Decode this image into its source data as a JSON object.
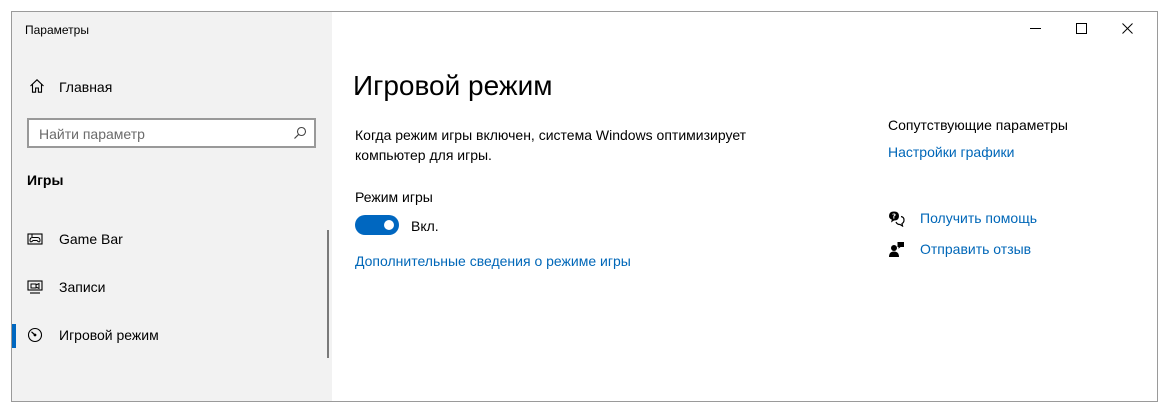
{
  "window": {
    "title": "Параметры"
  },
  "sidebar": {
    "home_label": "Главная",
    "search_placeholder": "Найти параметр",
    "section_title": "Игры",
    "items": [
      {
        "label": "Game Bar",
        "icon": "game-bar-icon"
      },
      {
        "label": "Записи",
        "icon": "captures-icon"
      },
      {
        "label": "Игровой режим",
        "icon": "game-mode-icon",
        "active": true
      }
    ]
  },
  "main": {
    "title": "Игровой режим",
    "description": "Когда режим игры включен, система Windows оптимизирует компьютер для игры.",
    "setting_label": "Режим игры",
    "toggle_on": true,
    "toggle_state": "Вкл.",
    "more_info_link": "Дополнительные сведения о режиме игры"
  },
  "related": {
    "title": "Сопутствующие параметры",
    "graphics_link": "Настройки графики"
  },
  "help": {
    "get_help": "Получить помощь",
    "send_feedback": "Отправить отзыв"
  },
  "colors": {
    "accent": "#0067c0",
    "link": "#0067b8",
    "sidebar_bg": "#f2f2f2"
  }
}
